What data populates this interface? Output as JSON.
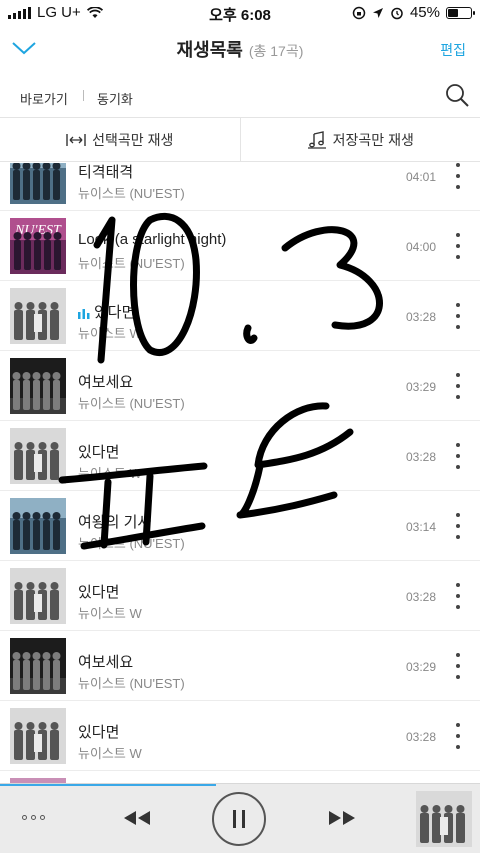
{
  "status_bar": {
    "carrier": "LG U+",
    "time": "오후 6:08",
    "battery": "45%",
    "battery_level": 0.45
  },
  "header": {
    "title": "재생목록",
    "count": "(총 17곡)",
    "edit_label": "편집"
  },
  "nav": {
    "goto_label": "바로가기",
    "sync_label": "동기화"
  },
  "filters": {
    "selected_label": "선택곡만 재생",
    "saved_label": "저장곡만 재생"
  },
  "songs": [
    {
      "title": "티격태격",
      "artist": "뉴이스트 (NU'EST)",
      "duration": "04:01",
      "cover": "band-blue"
    },
    {
      "title": "Look (a starlight night)",
      "artist": "뉴이스트 (NU'EST)",
      "duration": "04:00",
      "cover": "nuest-pink"
    },
    {
      "title": "있다면",
      "artist": "뉴이스트 W",
      "duration": "03:28",
      "cover": "w-gray",
      "playing": true
    },
    {
      "title": "여보세요",
      "artist": "뉴이스트 (NU'EST)",
      "duration": "03:29",
      "cover": "dark-stage"
    },
    {
      "title": "있다면",
      "artist": "뉴이스트 W",
      "duration": "03:28",
      "cover": "w-gray"
    },
    {
      "title": "여왕의 기사",
      "artist": "뉴이스트 (NU'EST)",
      "duration": "03:14",
      "cover": "band-blue"
    },
    {
      "title": "있다면",
      "artist": "뉴이스트 W",
      "duration": "03:28",
      "cover": "w-gray"
    },
    {
      "title": "여보세요",
      "artist": "뉴이스트 (NU'EST)",
      "duration": "03:29",
      "cover": "dark-stage"
    },
    {
      "title": "있다면",
      "artist": "뉴이스트 W",
      "duration": "03:28",
      "cover": "w-gray"
    },
    {
      "title": "",
      "artist": "",
      "duration": "",
      "cover": "pink-partial"
    }
  ],
  "player": {
    "progress": 0.45,
    "now_cover": "w-gray"
  },
  "colors": {
    "accent": "#1ea5e0",
    "progress": "#3aa8e8"
  },
  "icons": {
    "collapse": "chevron-down-icon",
    "search": "search-icon",
    "more": "more-vertical-icon",
    "equalizer": "equalizer-icon",
    "menu": "more-horizontal-icon",
    "prev": "previous-icon",
    "pause": "pause-icon",
    "next": "next-icon"
  }
}
